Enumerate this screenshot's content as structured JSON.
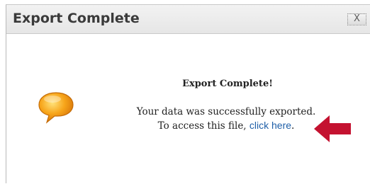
{
  "dialog": {
    "title": "Export Complete",
    "close_label": "X"
  },
  "content": {
    "heading": "Export Complete!",
    "line1": "Your data was successfully exported.",
    "line2_prefix": "To access this file, ",
    "link_text": "click here",
    "line2_suffix": "."
  },
  "icons": {
    "bubble": "speech-bubble-icon",
    "arrow": "arrow-left-icon"
  },
  "colors": {
    "link": "#1f5fa8",
    "arrow": "#c41230",
    "bubble": "#f7a51a"
  }
}
